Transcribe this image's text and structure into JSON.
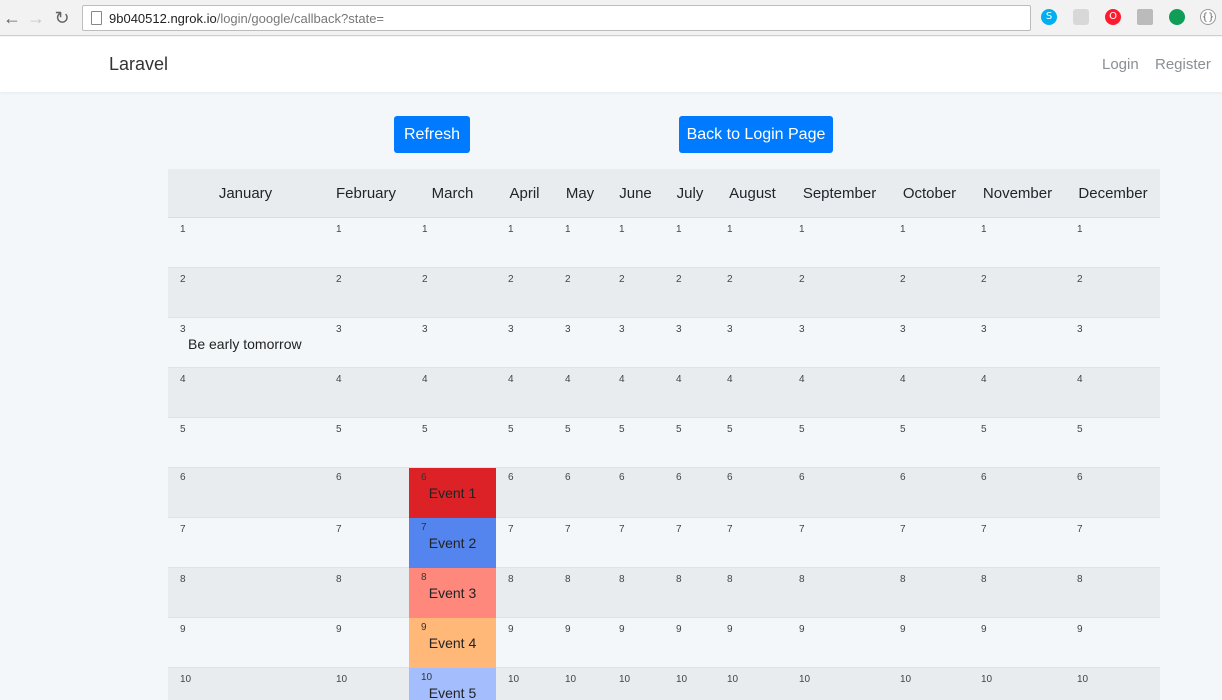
{
  "browser": {
    "url_host": "9b040512.ngrok.io",
    "url_path": "/login/google/callback?state=",
    "back": "←",
    "forward": "→",
    "reload": "↻"
  },
  "navbar": {
    "brand": "Laravel",
    "links": [
      "Login",
      "Register"
    ]
  },
  "actions": {
    "refresh_label": "Refresh",
    "back_label": "Back to Login Page"
  },
  "colors": {
    "primary": "#007bff",
    "event1": "#dc2226",
    "event2": "#5484ed",
    "event3": "#ff887c",
    "event4": "#ffb878",
    "event5": "#a4bdfc"
  },
  "calendar": {
    "months": [
      "January",
      "February",
      "March",
      "April",
      "May",
      "June",
      "July",
      "August",
      "September",
      "October",
      "November",
      "December"
    ],
    "days": [
      "1",
      "2",
      "3",
      "4",
      "5",
      "6",
      "7",
      "8",
      "9",
      "10"
    ],
    "notes": [
      {
        "month": "January",
        "day": "3",
        "text": "Be early tomorrow"
      }
    ],
    "events": [
      {
        "month": "March",
        "day": "6",
        "title": "Event 1",
        "color": "#dc2226"
      },
      {
        "month": "March",
        "day": "7",
        "title": "Event 2",
        "color": "#5484ed"
      },
      {
        "month": "March",
        "day": "8",
        "title": "Event 3",
        "color": "#ff887c"
      },
      {
        "month": "March",
        "day": "9",
        "title": "Event 4",
        "color": "#ffb878"
      },
      {
        "month": "March",
        "day": "10",
        "title": "Event 5",
        "color": "#a4bdfc"
      }
    ]
  }
}
